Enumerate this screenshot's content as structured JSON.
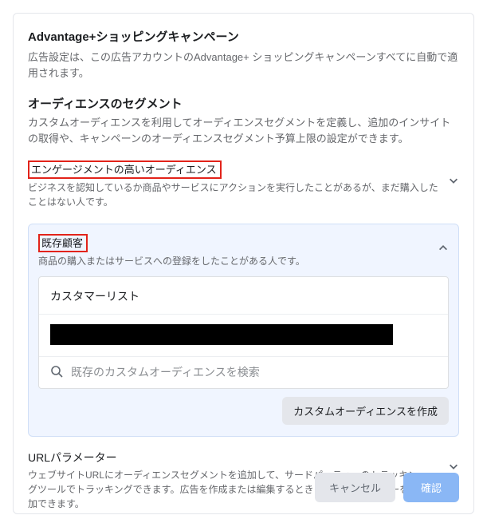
{
  "header": {
    "title": "Advantage+ショッピングキャンペーン",
    "desc": "広告設定は、この広告アカウントのAdvantage+ ショッピングキャンペーンすべてに自動で適用されます。"
  },
  "audience": {
    "title": "オーディエンスのセグメント",
    "desc": "カスタムオーディエンスを利用してオーディエンスセグメントを定義し、追加のインサイトの取得や、キャンペーンのオーディエンスセグメント予算上限の設定ができます。"
  },
  "engaged": {
    "title": "エンゲージメントの高いオーディエンス",
    "desc": "ビジネスを認知しているか商品やサービスにアクションを実行したことがあるが、まだ購入したことはない人です。"
  },
  "existing": {
    "title": "既存顧客",
    "desc": "商品の購入またはサービスへの登録をしたことがある人です。",
    "card_header": "カスタマーリスト",
    "search_placeholder": "既存のカスタムオーディエンスを検索",
    "create_label": "カスタムオーディエンスを作成"
  },
  "url": {
    "title": "URLパラメーター",
    "desc": "ウェブサイトURLにオーディエンスセグメントを追加して、サードパーティーのトラッキングツールでトラッキングできます。広告を作成または編集するときに他のパラメーターを追加できます。"
  },
  "footer": {
    "cancel": "キャンセル",
    "confirm": "確認"
  }
}
